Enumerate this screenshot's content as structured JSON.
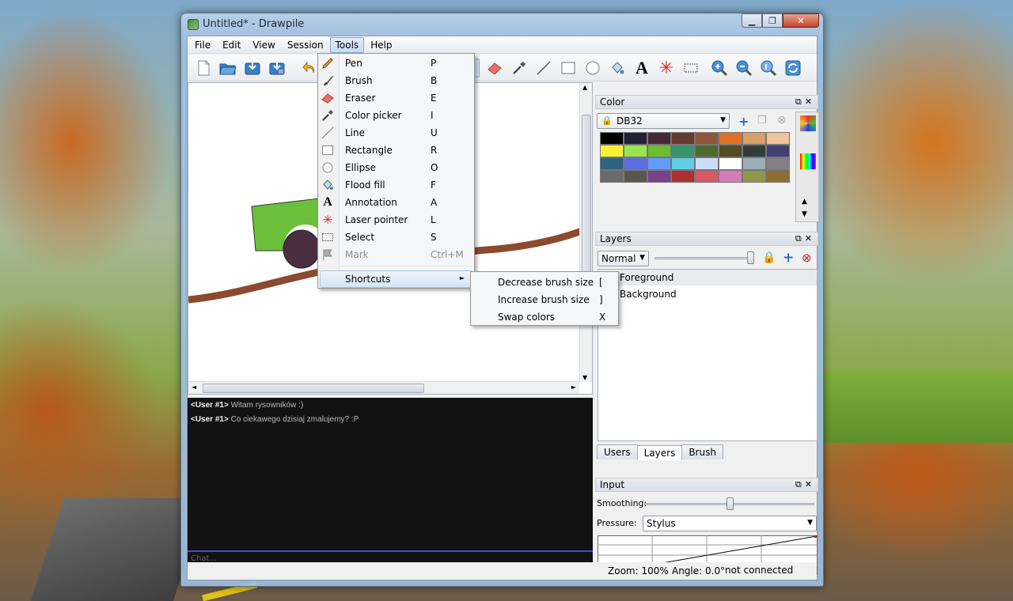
{
  "window": {
    "title": "Untitled* - Drawpile",
    "controls": {
      "minimize": "▁",
      "maximize": "❐",
      "close": "✕"
    }
  },
  "menubar": [
    "File",
    "Edit",
    "View",
    "Session",
    "Tools",
    "Help"
  ],
  "tools_menu": [
    {
      "label": "Pen",
      "shortcut": "P",
      "icon": "pen-icon"
    },
    {
      "label": "Brush",
      "shortcut": "B",
      "icon": "brush-icon"
    },
    {
      "label": "Eraser",
      "shortcut": "E",
      "icon": "eraser-icon"
    },
    {
      "label": "Color picker",
      "shortcut": "I",
      "icon": "color-picker-icon"
    },
    {
      "label": "Line",
      "shortcut": "U",
      "icon": "line-icon"
    },
    {
      "label": "Rectangle",
      "shortcut": "R",
      "icon": "rectangle-icon"
    },
    {
      "label": "Ellipse",
      "shortcut": "O",
      "icon": "ellipse-icon"
    },
    {
      "label": "Flood fill",
      "shortcut": "F",
      "icon": "flood-fill-icon"
    },
    {
      "label": "Annotation",
      "shortcut": "A",
      "icon": "annotation-icon"
    },
    {
      "label": "Laser pointer",
      "shortcut": "L",
      "icon": "laser-pointer-icon"
    },
    {
      "label": "Select",
      "shortcut": "S",
      "icon": "select-icon"
    },
    {
      "label": "Mark",
      "shortcut": "Ctrl+M",
      "icon": "mark-icon",
      "disabled": true
    }
  ],
  "shortcuts_menu": {
    "label": "Shortcuts",
    "arrow": "►",
    "items": [
      {
        "label": "Decrease brush size",
        "shortcut": "["
      },
      {
        "label": "Increase brush size",
        "shortcut": "]"
      },
      {
        "label": "Swap colors",
        "shortcut": "X"
      }
    ]
  },
  "chat": {
    "messages": [
      {
        "user": "<User #1>",
        "text": " Witam rysowników :)"
      },
      {
        "user": "<User #1>",
        "text": " Co ciekawego dzisiaj zmalujemy? :P"
      }
    ],
    "placeholder": "Chat..."
  },
  "color_panel": {
    "title": "Color",
    "palette_name": "DB32",
    "swatches": [
      "#000000",
      "#222034",
      "#45283c",
      "#663931",
      "#8f563b",
      "#df7126",
      "#d9a066",
      "#eec39a",
      "#fbf236",
      "#99e550",
      "#6abe30",
      "#37946e",
      "#4b692f",
      "#524b24",
      "#323c39",
      "#3f3f74",
      "#306082",
      "#5b6ee1",
      "#639bff",
      "#5fcde4",
      "#cbdbfc",
      "#ffffff",
      "#9badb7",
      "#847e87",
      "#696a6a",
      "#595652",
      "#76428a",
      "#ac3232",
      "#d95763",
      "#d77bba",
      "#8f974a",
      "#8a6f30"
    ]
  },
  "layers_panel": {
    "title": "Layers",
    "blend_mode": "Normal",
    "layers": [
      "Foreground",
      "Background"
    ]
  },
  "dock_tabs": [
    "Users",
    "Layers",
    "Brush"
  ],
  "input_panel": {
    "title": "Input",
    "smoothing_label": "Smoothing:",
    "smoothing_value": 0.6,
    "pressure_label": "Pressure:",
    "pressure_value": "Stylus"
  },
  "status": {
    "zoom": "Zoom: 100%",
    "angle": "Angle: 0.0°",
    "connection": "not connected"
  },
  "colors": {
    "accent": "#3f4bd8",
    "chat_bg": "#121212",
    "stroke_brown": "#8b4a2e",
    "shape_green": "#6cbf3a",
    "circle_dark": "#4a2d3e"
  }
}
